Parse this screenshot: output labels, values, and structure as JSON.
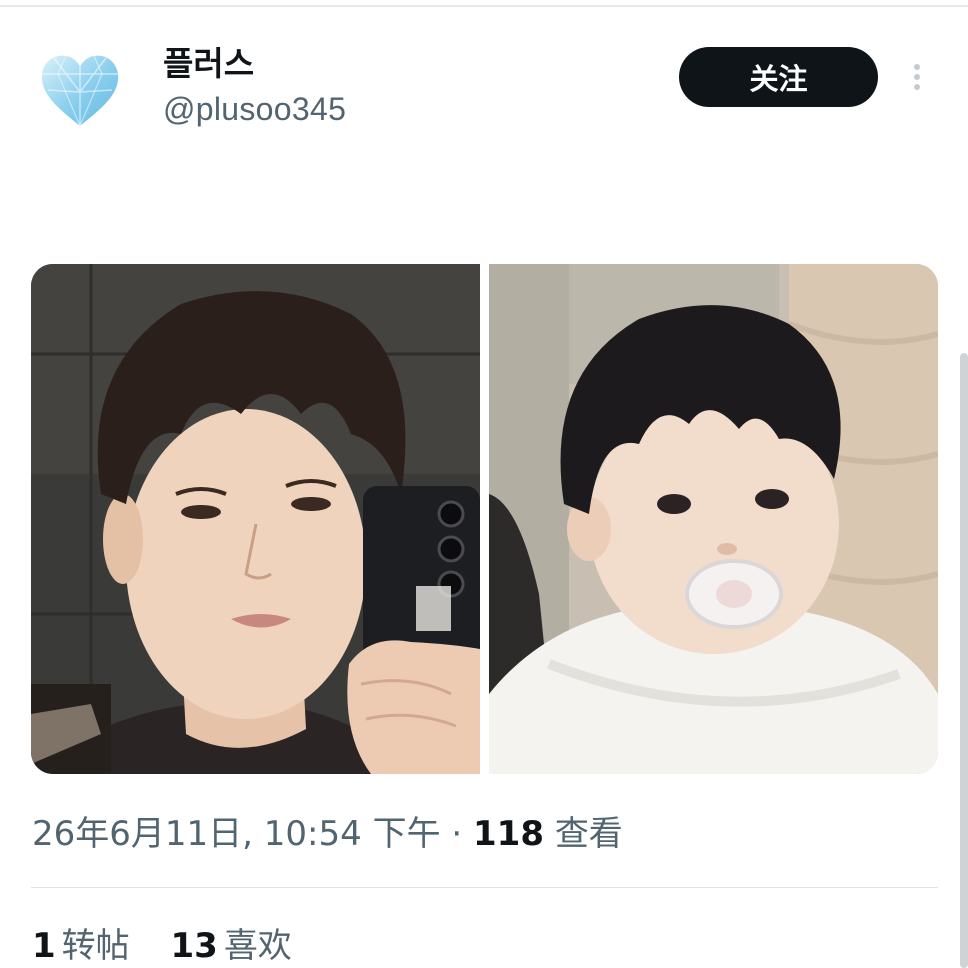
{
  "profile": {
    "display_name": "플러스",
    "handle": "@plusoo345",
    "avatar_icon": "blue-diamond-heart-icon"
  },
  "actions": {
    "follow_label": "关注",
    "more_icon": "more-vertical-icon"
  },
  "media": {
    "images": [
      {
        "name": "mirror-selfie-photo"
      },
      {
        "name": "baby-with-pacifier-photo"
      }
    ]
  },
  "meta": {
    "timestamp": "26年6月11日, 10:54 下午",
    "separator": "·",
    "views_count": "118",
    "views_label": "查看"
  },
  "stats": {
    "reposts_count": "1",
    "reposts_label": "转帖",
    "likes_count": "13",
    "likes_label": "喜欢"
  },
  "colors": {
    "text_primary": "#0f1419",
    "text_secondary": "#536471",
    "follow_bg": "#0f1419",
    "follow_text": "#ffffff",
    "avatar_accent": "#9fd6ef"
  }
}
